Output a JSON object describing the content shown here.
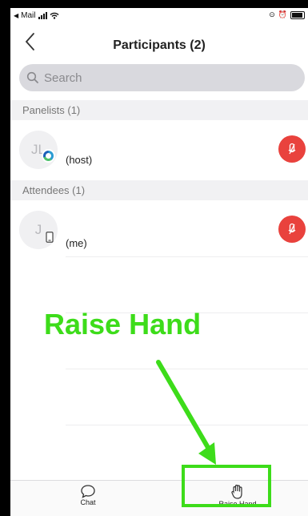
{
  "status_bar": {
    "carrier": "Mail"
  },
  "header": {
    "title": "Participants (2)"
  },
  "search": {
    "placeholder": "Search"
  },
  "panelists": {
    "heading": "Panelists (1)",
    "items": [
      {
        "initials": "JL",
        "role": "(host)"
      }
    ]
  },
  "attendees": {
    "heading": "Attendees (1)",
    "items": [
      {
        "initials": "J",
        "role": "(me)"
      }
    ]
  },
  "annotation": {
    "text": "Raise Hand",
    "color": "#3ddc1a"
  },
  "tabbar": {
    "chat_label": "Chat",
    "raise_hand_label": "Raise Hand"
  },
  "colors": {
    "mic_muted": "#e9423d",
    "highlight": "#3ddc1a"
  },
  "icons": [
    "back-chevron-icon",
    "search-icon",
    "mic-muted-icon",
    "host-badge-icon",
    "phone-device-icon",
    "chat-icon",
    "hand-icon"
  ]
}
